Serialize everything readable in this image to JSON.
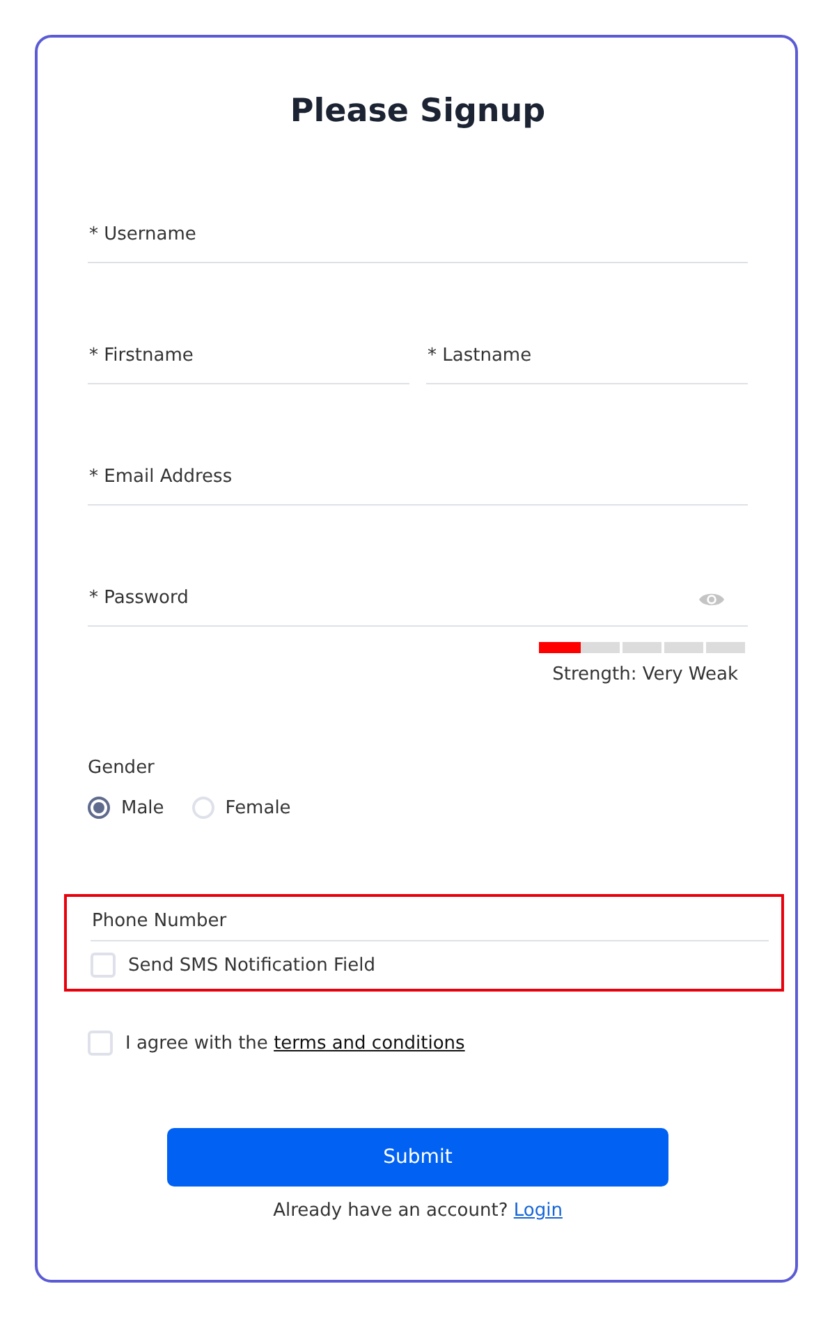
{
  "title": "Please Signup",
  "fields": [
    {
      "kind": "text",
      "placeholder": "* Username"
    },
    {
      "kind": "pair",
      "items": [
        {
          "placeholder": "* Firstname"
        },
        {
          "placeholder": "* Lastname"
        }
      ]
    },
    {
      "kind": "text",
      "placeholder": "* Email Address"
    },
    {
      "kind": "password",
      "placeholder": "* Password"
    }
  ],
  "strength": {
    "level": 0.2,
    "label": "Strength: Very Weak"
  },
  "gender": {
    "label": "Gender",
    "options": [
      {
        "label": "Male",
        "selected": true
      },
      {
        "label": "Female",
        "selected": false
      }
    ]
  },
  "phone_section": {
    "highlighted": true,
    "placeholder": "Phone Number",
    "sms": {
      "label": "Send SMS Notification Field",
      "checked": false
    }
  },
  "agree": {
    "checked": false,
    "text": "I agree with the ",
    "link": "terms and conditions"
  },
  "submit": "Submit",
  "footer": {
    "text": "Already have an account? ",
    "link": "Login"
  }
}
